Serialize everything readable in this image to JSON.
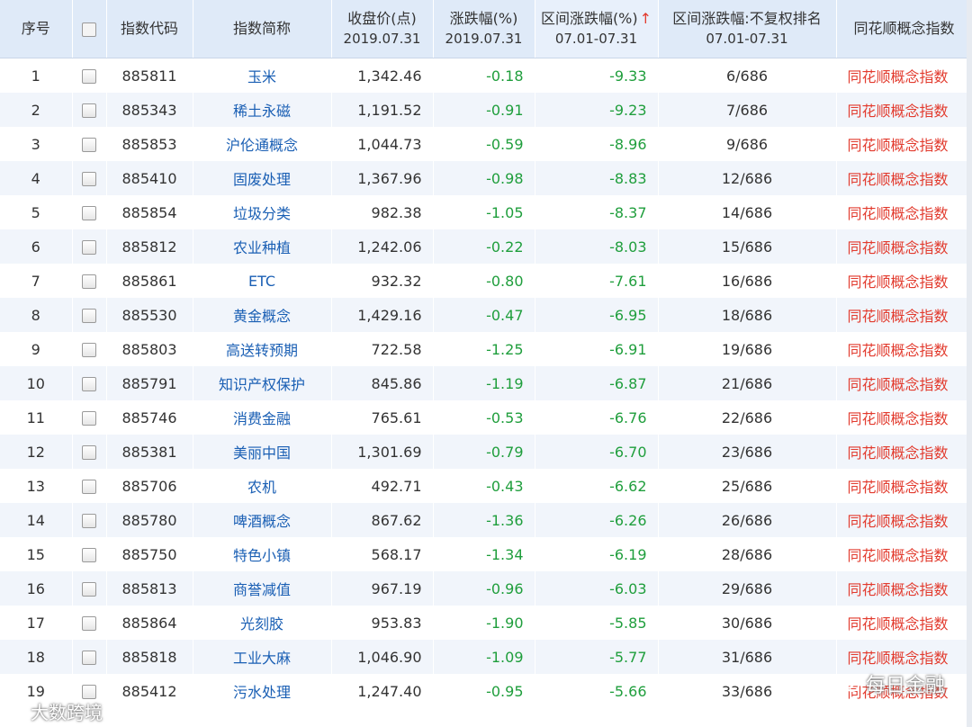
{
  "header": {
    "idx": "序号",
    "code": "指数代码",
    "name": "指数简称",
    "close_title": "收盘价(点)",
    "close_date": "2019.07.31",
    "chg_title": "涨跌幅(%)",
    "chg_date": "2019.07.31",
    "range_title": "区间涨跌幅(%)",
    "range_date": "07.01-07.31",
    "sort_arrow": "↑",
    "rank_title": "区间涨跌幅:不复权排名",
    "rank_date": "07.01-07.31",
    "category": "同花顺概念指数"
  },
  "rows": [
    {
      "idx": "1",
      "code": "885811",
      "name": "玉米",
      "close": "1,342.46",
      "chg": "-0.18",
      "range": "-9.33",
      "rank": "6/686",
      "category": "同花顺概念指数"
    },
    {
      "idx": "2",
      "code": "885343",
      "name": "稀土永磁",
      "close": "1,191.52",
      "chg": "-0.91",
      "range": "-9.23",
      "rank": "7/686",
      "category": "同花顺概念指数"
    },
    {
      "idx": "3",
      "code": "885853",
      "name": "沪伦通概念",
      "close": "1,044.73",
      "chg": "-0.59",
      "range": "-8.96",
      "rank": "9/686",
      "category": "同花顺概念指数"
    },
    {
      "idx": "4",
      "code": "885410",
      "name": "固废处理",
      "close": "1,367.96",
      "chg": "-0.98",
      "range": "-8.83",
      "rank": "12/686",
      "category": "同花顺概念指数"
    },
    {
      "idx": "5",
      "code": "885854",
      "name": "垃圾分类",
      "close": "982.38",
      "chg": "-1.05",
      "range": "-8.37",
      "rank": "14/686",
      "category": "同花顺概念指数"
    },
    {
      "idx": "6",
      "code": "885812",
      "name": "农业种植",
      "close": "1,242.06",
      "chg": "-0.22",
      "range": "-8.03",
      "rank": "15/686",
      "category": "同花顺概念指数"
    },
    {
      "idx": "7",
      "code": "885861",
      "name": "ETC",
      "close": "932.32",
      "chg": "-0.80",
      "range": "-7.61",
      "rank": "16/686",
      "category": "同花顺概念指数"
    },
    {
      "idx": "8",
      "code": "885530",
      "name": "黄金概念",
      "close": "1,429.16",
      "chg": "-0.47",
      "range": "-6.95",
      "rank": "18/686",
      "category": "同花顺概念指数"
    },
    {
      "idx": "9",
      "code": "885803",
      "name": "高送转预期",
      "close": "722.58",
      "chg": "-1.25",
      "range": "-6.91",
      "rank": "19/686",
      "category": "同花顺概念指数"
    },
    {
      "idx": "10",
      "code": "885791",
      "name": "知识产权保护",
      "close": "845.86",
      "chg": "-1.19",
      "range": "-6.87",
      "rank": "21/686",
      "category": "同花顺概念指数"
    },
    {
      "idx": "11",
      "code": "885746",
      "name": "消费金融",
      "close": "765.61",
      "chg": "-0.53",
      "range": "-6.76",
      "rank": "22/686",
      "category": "同花顺概念指数"
    },
    {
      "idx": "12",
      "code": "885381",
      "name": "美丽中国",
      "close": "1,301.69",
      "chg": "-0.79",
      "range": "-6.70",
      "rank": "23/686",
      "category": "同花顺概念指数"
    },
    {
      "idx": "13",
      "code": "885706",
      "name": "农机",
      "close": "492.71",
      "chg": "-0.43",
      "range": "-6.62",
      "rank": "25/686",
      "category": "同花顺概念指数"
    },
    {
      "idx": "14",
      "code": "885780",
      "name": "啤酒概念",
      "close": "867.62",
      "chg": "-1.36",
      "range": "-6.26",
      "rank": "26/686",
      "category": "同花顺概念指数"
    },
    {
      "idx": "15",
      "code": "885750",
      "name": "特色小镇",
      "close": "568.17",
      "chg": "-1.34",
      "range": "-6.19",
      "rank": "28/686",
      "category": "同花顺概念指数"
    },
    {
      "idx": "16",
      "code": "885813",
      "name": "商誉减值",
      "close": "967.19",
      "chg": "-0.96",
      "range": "-6.03",
      "rank": "29/686",
      "category": "同花顺概念指数"
    },
    {
      "idx": "17",
      "code": "885864",
      "name": "光刻胶",
      "close": "953.83",
      "chg": "-1.90",
      "range": "-5.85",
      "rank": "30/686",
      "category": "同花顺概念指数"
    },
    {
      "idx": "18",
      "code": "885818",
      "name": "工业大麻",
      "close": "1,046.90",
      "chg": "-1.09",
      "range": "-5.77",
      "rank": "31/686",
      "category": "同花顺概念指数"
    },
    {
      "idx": "19",
      "code": "885412",
      "name": "污水处理",
      "close": "1,247.40",
      "chg": "-0.95",
      "range": "-5.66",
      "rank": "33/686",
      "category": "同花顺概念指数"
    }
  ],
  "watermarks": {
    "right": "每日金融",
    "left": "大数跨境"
  },
  "colors": {
    "header_bg": "#dfeaf8",
    "alt_row_bg": "#f1f5fb",
    "link_blue": "#1a5fb4",
    "down_green": "#1f9e3c",
    "category_red": "#e23b2e"
  }
}
